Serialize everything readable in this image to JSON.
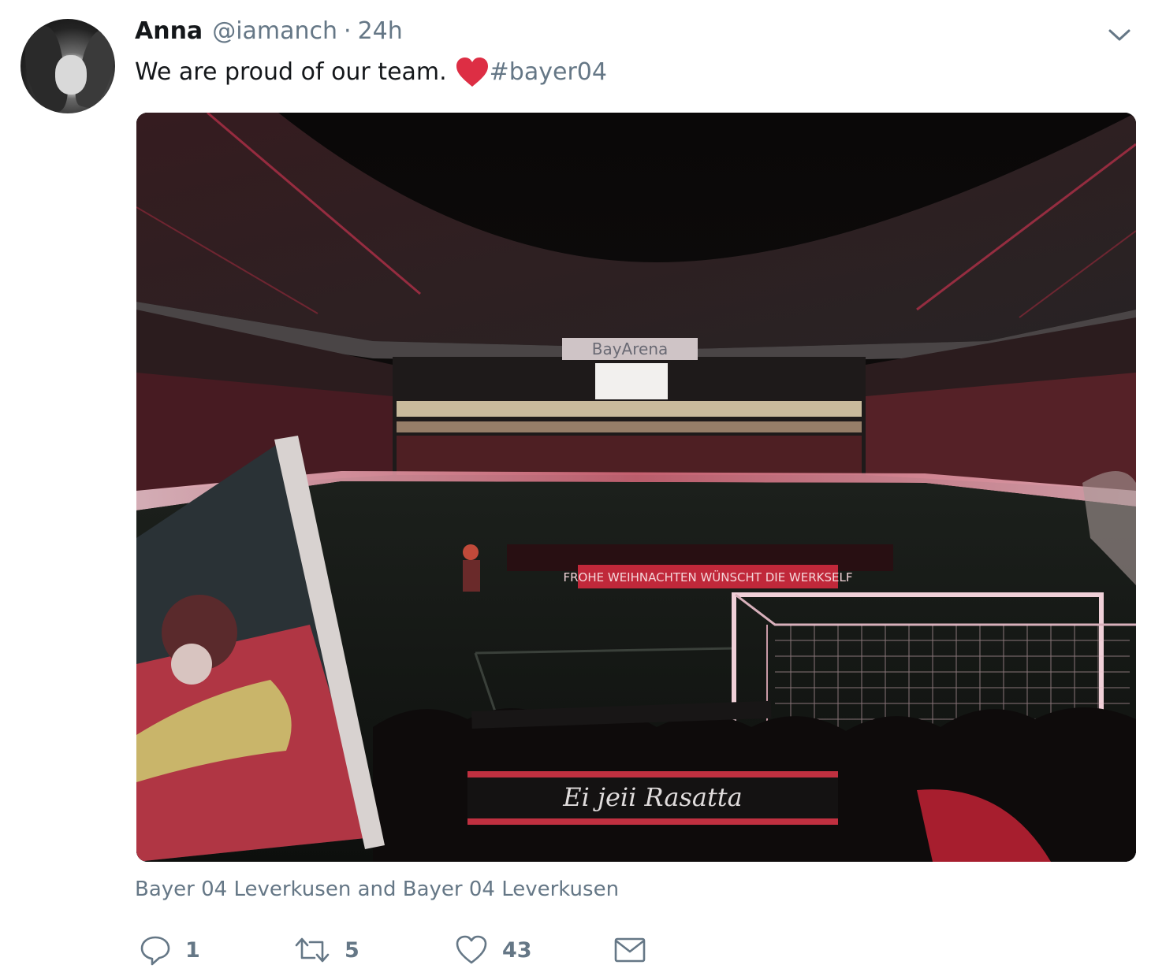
{
  "tweet": {
    "author_name": "Anna",
    "author_handle": "@iamanch",
    "separator": "·",
    "timestamp": "24h",
    "text": "We are proud of our team.",
    "hashtag": "#bayer04",
    "location": "Bayer 04 Leverkusen and Bayer 04 Leverkusen"
  },
  "media": {
    "stadium_sign": "BayArena",
    "banner_text": "FROHE WEIHNACHTEN WÜNSCHT DIE WERKSELF",
    "scarf_text": "Ei jeii Rasatta"
  },
  "actions": {
    "reply_count": "1",
    "retweet_count": "5",
    "like_count": "43"
  },
  "colors": {
    "text_primary": "#14171a",
    "text_secondary": "#657786",
    "heart_emoji": "#dd2e44"
  }
}
